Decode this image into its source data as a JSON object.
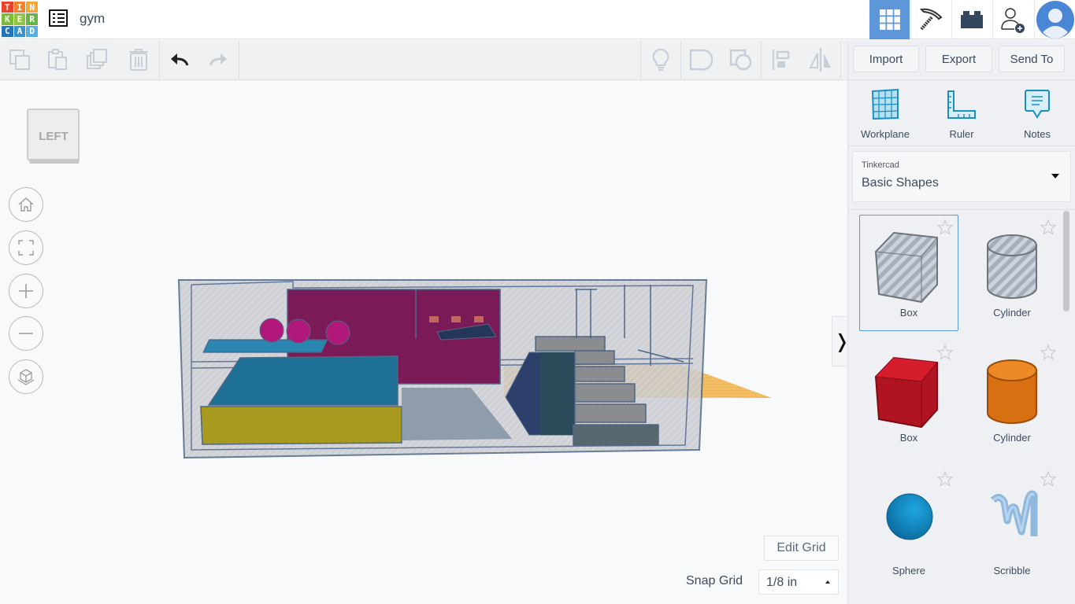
{
  "app": {
    "logo_letters": [
      "T",
      "I",
      "N",
      "K",
      "E",
      "R",
      "C",
      "A",
      "D"
    ],
    "logo_colors": [
      "#e8452c",
      "#f4822a",
      "#f6a734",
      "#7cbb38",
      "#8dc63f",
      "#66b645",
      "#2475bb",
      "#3793d1",
      "#52b0e4"
    ],
    "design_title": "gym"
  },
  "topbar": {
    "icons": [
      "3d-design-grid-icon",
      "minecraft-pickaxe-icon",
      "lego-brick-icon",
      "invite-user-icon",
      "user-avatar"
    ],
    "active_color": "#5d97d9"
  },
  "toolbar": {
    "edit_tools": [
      "copy",
      "paste",
      "duplicate",
      "delete"
    ],
    "history": [
      "undo",
      "redo"
    ],
    "view_tools": [
      "show-hide-light",
      "group",
      "ungroup",
      "align",
      "mirror"
    ],
    "import_label": "Import",
    "export_label": "Export",
    "send_to_label": "Send To"
  },
  "right_panel": {
    "tools": [
      {
        "label": "Workplane",
        "icon": "workplane-icon"
      },
      {
        "label": "Ruler",
        "icon": "ruler-icon"
      },
      {
        "label": "Notes",
        "icon": "notes-icon"
      }
    ],
    "library": {
      "category": "Tinkercad",
      "selected": "Basic Shapes"
    },
    "shapes": [
      {
        "name": "Box",
        "variant": "hole",
        "selected": true
      },
      {
        "name": "Cylinder",
        "variant": "hole",
        "selected": false
      },
      {
        "name": "Box",
        "variant": "solid",
        "color": "#c8182a",
        "selected": false
      },
      {
        "name": "Cylinder",
        "variant": "solid",
        "color": "#e07a14",
        "selected": false
      },
      {
        "name": "Sphere",
        "variant": "solid",
        "color": "#1f8cc7",
        "selected": false
      },
      {
        "name": "Scribble",
        "variant": "solid",
        "color": "#8fb8dd",
        "selected": false
      }
    ]
  },
  "canvas": {
    "viewcube_face": "LEFT",
    "nav_buttons": [
      "home-view",
      "fit-all",
      "zoom-in",
      "zoom-out",
      "perspective-toggle"
    ],
    "edit_grid_label": "Edit Grid",
    "snap_grid_label": "Snap Grid",
    "snap_grid_value": "1/8 in",
    "collapse_glyph": "❭"
  }
}
